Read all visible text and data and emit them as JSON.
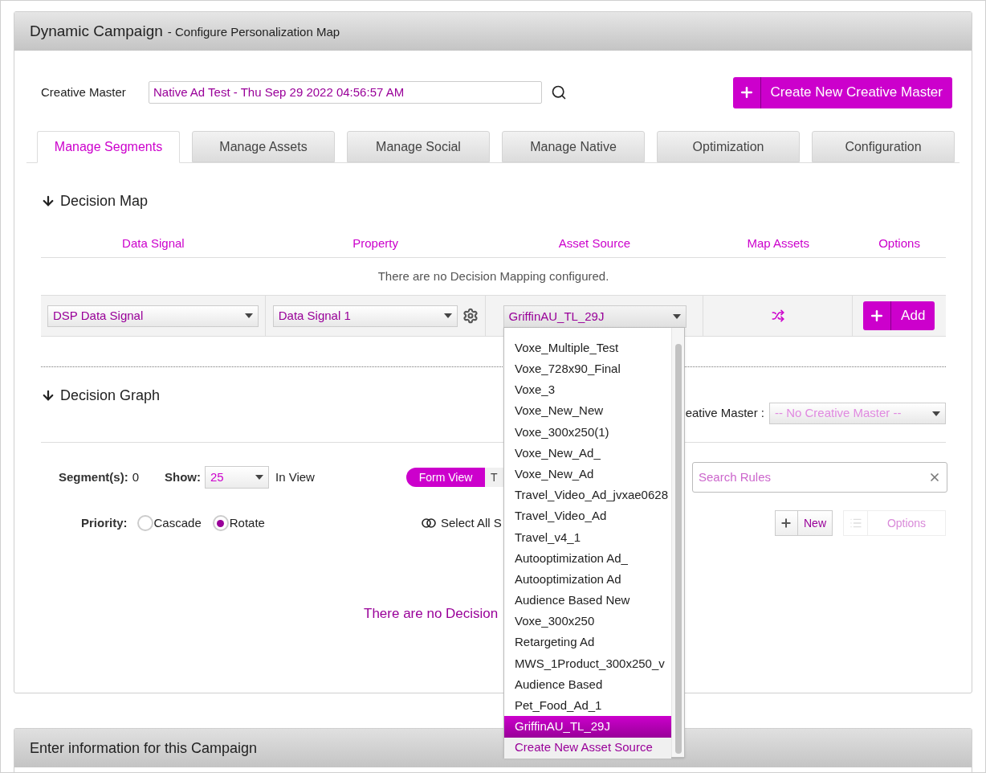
{
  "header": {
    "title": "Dynamic Campaign",
    "subtitle": "- Configure Personalization Map"
  },
  "creative_master": {
    "label": "Creative Master",
    "value": "Native Ad Test - Thu Sep 29 2022 04:56:57 AM",
    "create_button": "Create New Creative Master"
  },
  "tabs": [
    {
      "label": "Manage Segments",
      "selected": true
    },
    {
      "label": "Manage Assets",
      "selected": false
    },
    {
      "label": "Manage Social",
      "selected": false
    },
    {
      "label": "Manage Native",
      "selected": false
    },
    {
      "label": "Optimization",
      "selected": false
    },
    {
      "label": "Configuration",
      "selected": false
    }
  ],
  "decision_map": {
    "title": "Decision Map",
    "columns": [
      "Data Signal",
      "Property",
      "Asset Source",
      "Map Assets",
      "Options"
    ],
    "empty_message": "There are no Decision Mapping configured.",
    "row": {
      "data_signal": "DSP Data Signal",
      "property": "Data Signal 1",
      "asset_source": "GriffinAU_TL_29J",
      "add_button": "Add"
    }
  },
  "asset_source_dropdown": {
    "options": [
      {
        "label": "Voxe_Multiple_Test",
        "selected": false
      },
      {
        "label": "Voxe_728x90_Final",
        "selected": false
      },
      {
        "label": "Voxe_3",
        "selected": false
      },
      {
        "label": "Voxe_New_New",
        "selected": false
      },
      {
        "label": "Voxe_300x250(1)",
        "selected": false
      },
      {
        "label": "Voxe_New_Ad_",
        "selected": false
      },
      {
        "label": "Voxe_New_Ad",
        "selected": false
      },
      {
        "label": "Travel_Video_Ad_jvxae0628",
        "selected": false
      },
      {
        "label": "Travel_Video_Ad",
        "selected": false
      },
      {
        "label": "Travel_v4_1",
        "selected": false
      },
      {
        "label": "Autooptimization Ad_",
        "selected": false
      },
      {
        "label": "Autooptimization Ad",
        "selected": false
      },
      {
        "label": "Audience Based New",
        "selected": false
      },
      {
        "label": "Voxe_300x250",
        "selected": false
      },
      {
        "label": "Retargeting Ad",
        "selected": false
      },
      {
        "label": "MWS_1Product_300x250_v",
        "selected": false
      },
      {
        "label": "Audience Based",
        "selected": false
      },
      {
        "label": "Pet_Food_Ad_1",
        "selected": false
      },
      {
        "label": "GriffinAU_TL_29J",
        "selected": true
      }
    ],
    "create_link": "Create New Asset Source"
  },
  "decision_graph": {
    "title": "Decision Graph",
    "creative_master_label": "eative Master :",
    "creative_master_value": "-- No Creative Master --",
    "segments_label": "Segment(s):",
    "segments_count": "0",
    "show_label": "Show:",
    "show_value": "25",
    "in_view": "In View",
    "view_toggle": [
      {
        "label": "Form View",
        "selected": true
      },
      {
        "label": "T",
        "selected": false
      }
    ],
    "search_placeholder": "Search Rules",
    "priority_label": "Priority:",
    "priority_options": [
      {
        "label": "Cascade",
        "selected": false
      },
      {
        "label": "Rotate",
        "selected": true
      }
    ],
    "select_all": "Select All S",
    "new_button": "New",
    "options_button": {
      "label": "Options",
      "disabled": true
    },
    "empty_message": "There are no Decision"
  },
  "footer_panel": {
    "title": "Enter information for this Campaign"
  }
}
